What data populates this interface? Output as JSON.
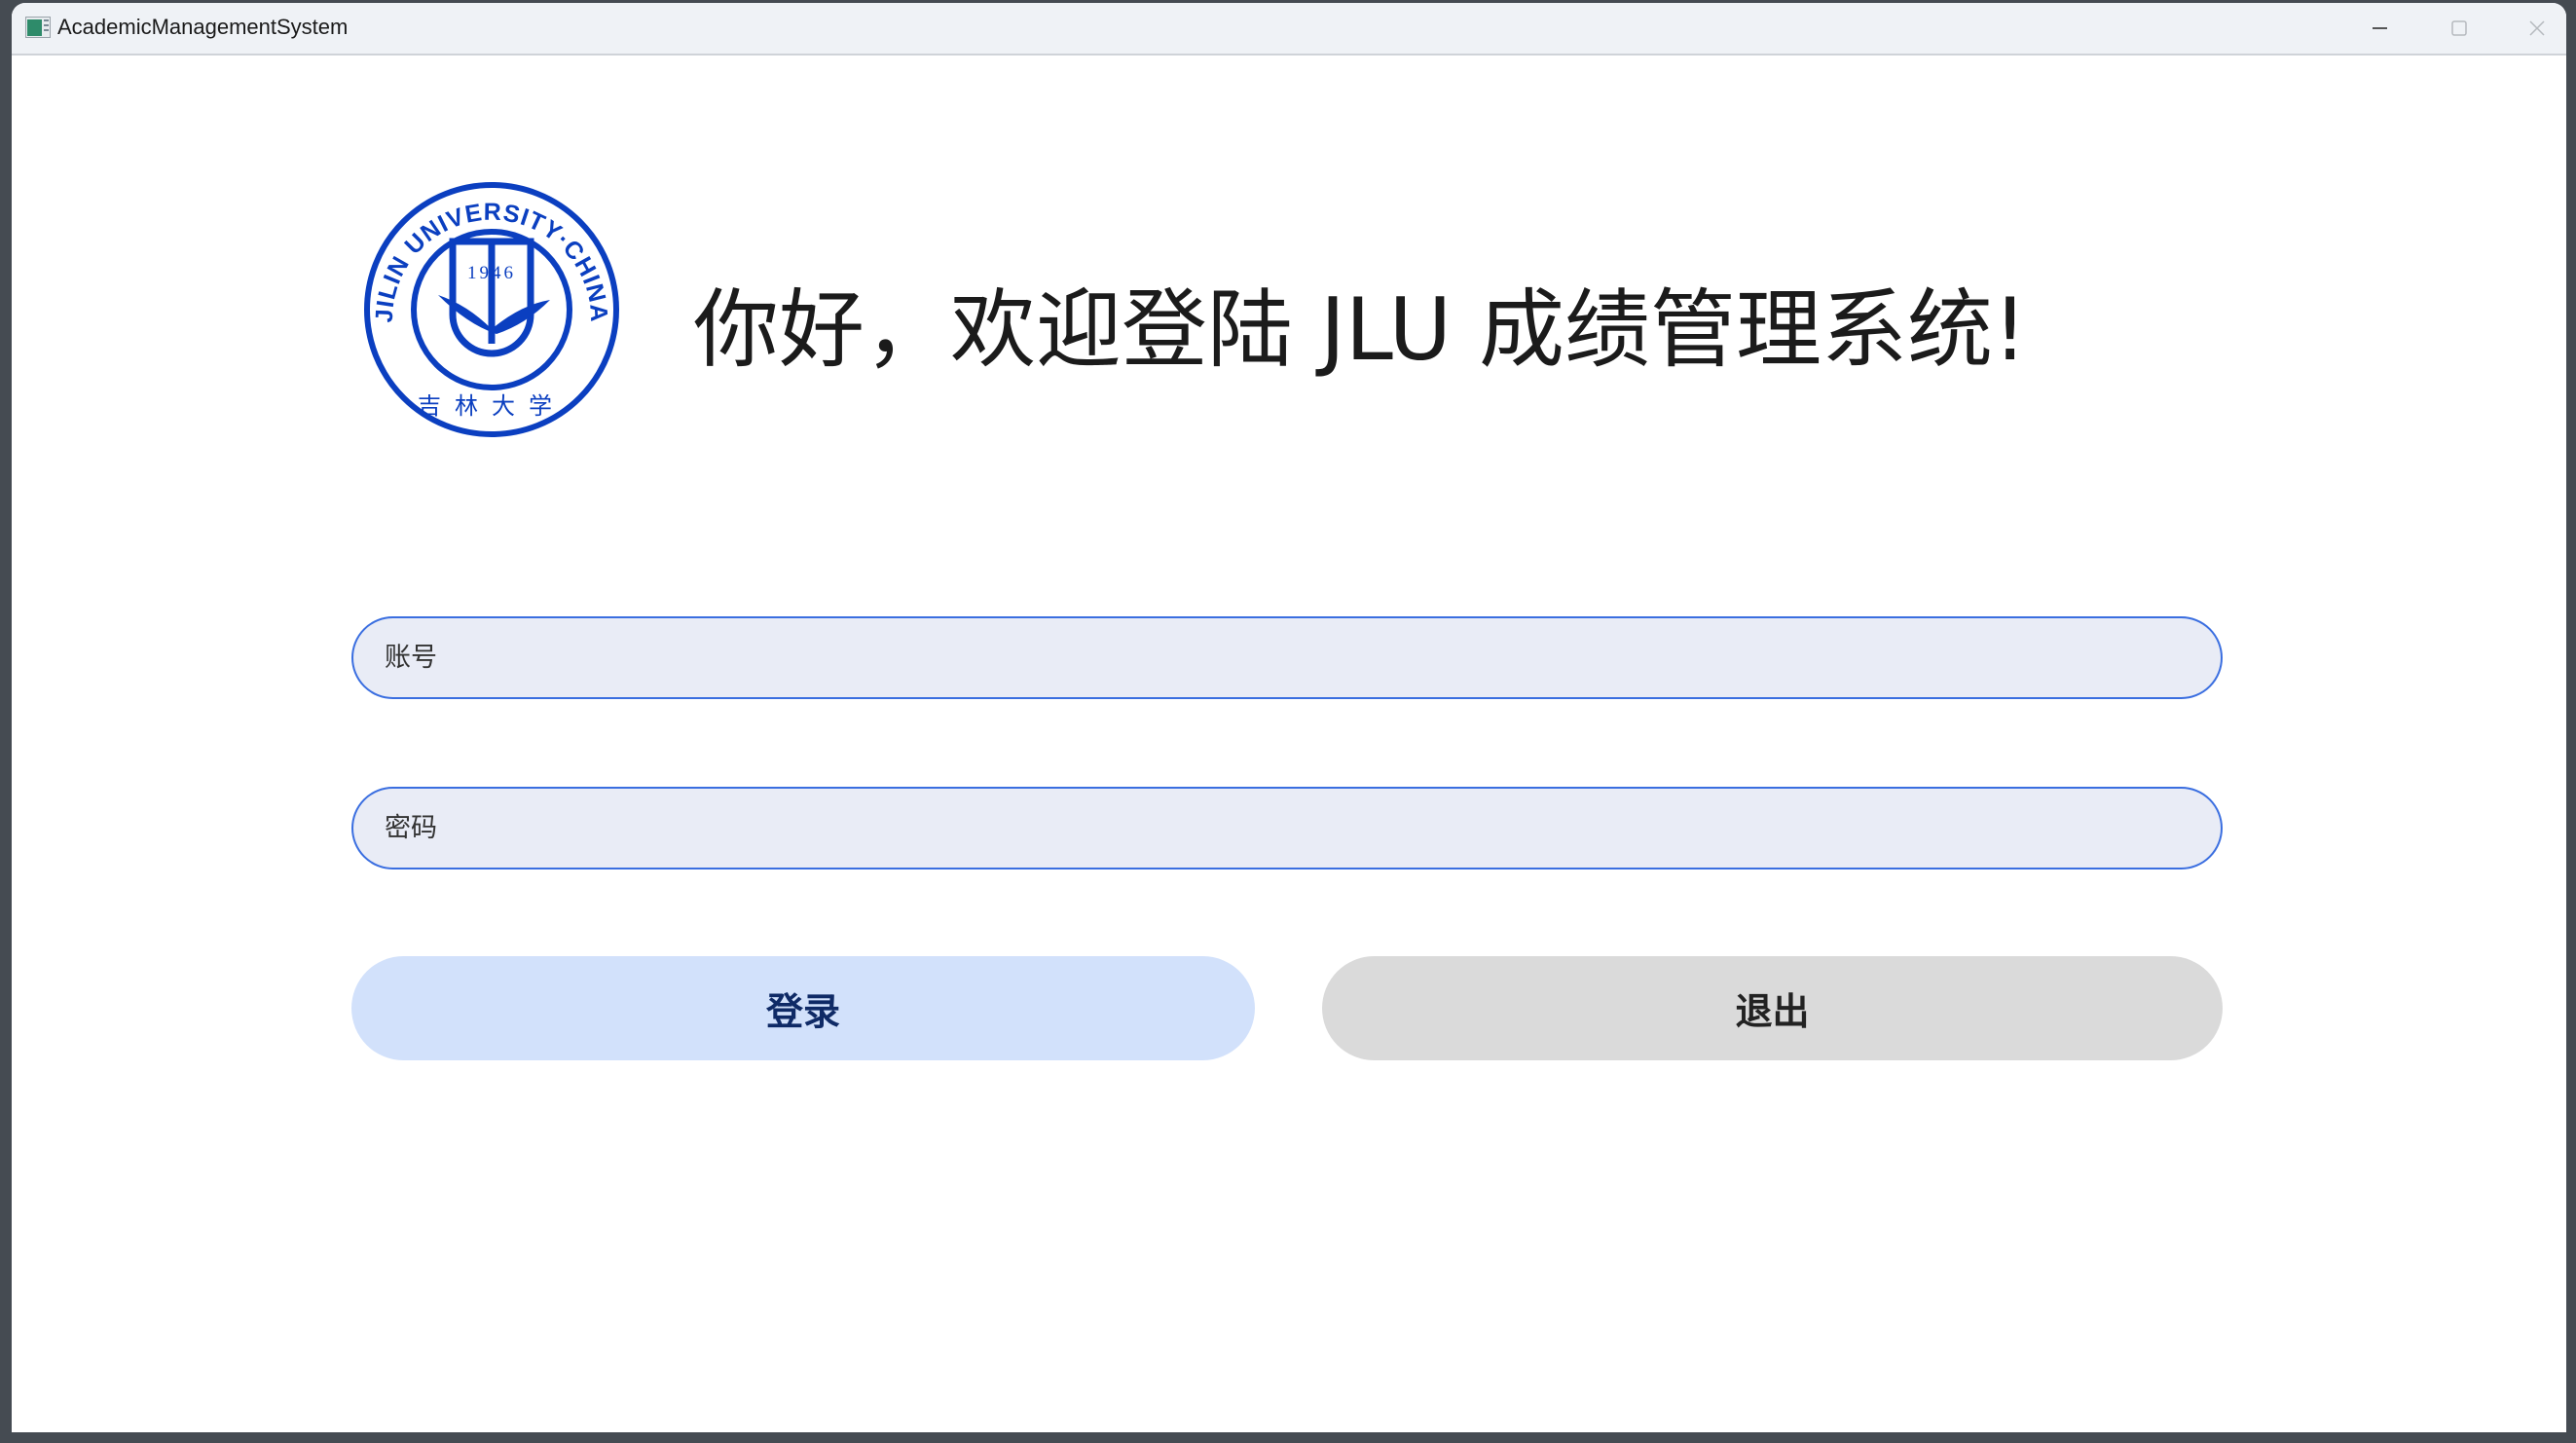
{
  "window": {
    "title": "AcademicManagementSystem",
    "icon": "app-window-icon"
  },
  "controls": {
    "minimize": "minimize-icon",
    "maximize": "maximize-icon",
    "close": "close-icon"
  },
  "logo": {
    "ring_text": "JILIN UNIVERSITY·CHINA",
    "year": "1946",
    "chinese": "吉林大学",
    "color": "#0b3fc0"
  },
  "heading": "你好，欢迎登陆 JLU 成绩管理系统!",
  "form": {
    "account_placeholder": "账号",
    "account_value": "",
    "password_placeholder": "密码",
    "password_value": "",
    "login_label": "登录",
    "exit_label": "退出"
  },
  "colors": {
    "field_border": "#3a6ee0",
    "field_bg": "#e9ecf6",
    "login_bg": "#d2e1fb",
    "exit_bg": "#dadada"
  }
}
